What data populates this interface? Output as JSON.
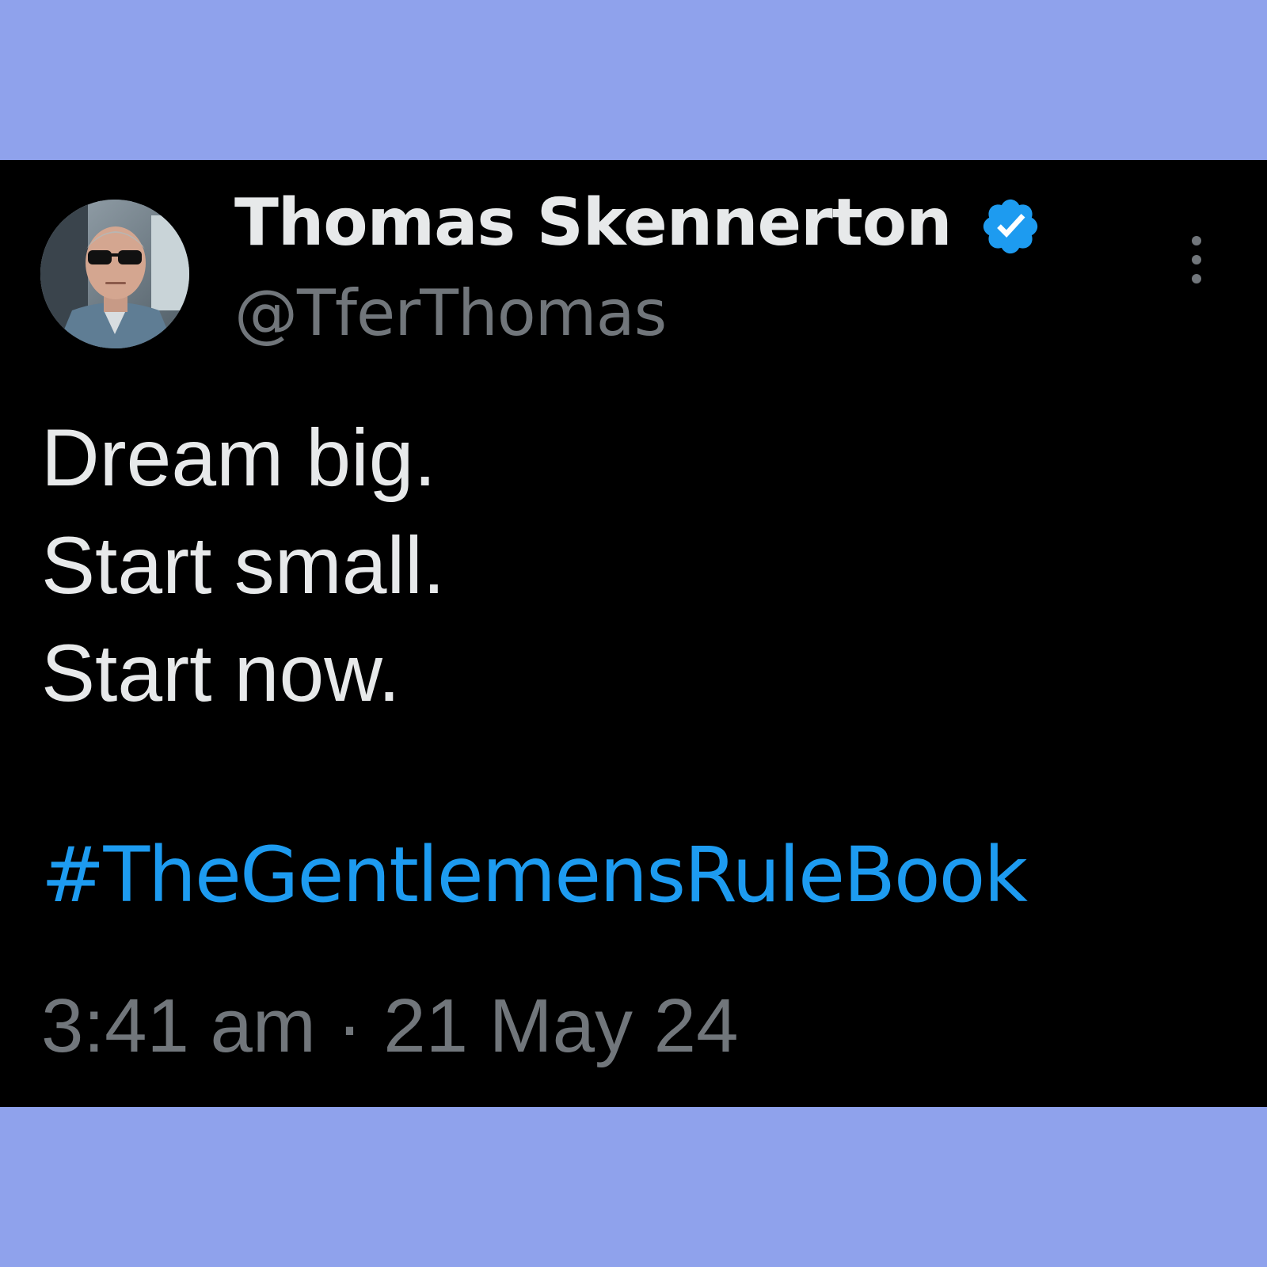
{
  "tweet": {
    "author": {
      "display_name": "Thomas Skennerton",
      "handle": "@TferThomas",
      "verified": true,
      "avatar_icon": "profile-photo-sunglasses"
    },
    "body_lines": [
      "Dream big.",
      "Start small.",
      "Start now."
    ],
    "hashtag": "#TheGentlemensRuleBook",
    "timestamp": "3:41 am · 21 May 24",
    "more_icon": "vertical-ellipsis-icon"
  },
  "colors": {
    "background": "#8fa2ec",
    "card": "#000000",
    "primary_text": "#e7e9ea",
    "secondary_text": "#71767b",
    "accent": "#1d9bf0"
  }
}
